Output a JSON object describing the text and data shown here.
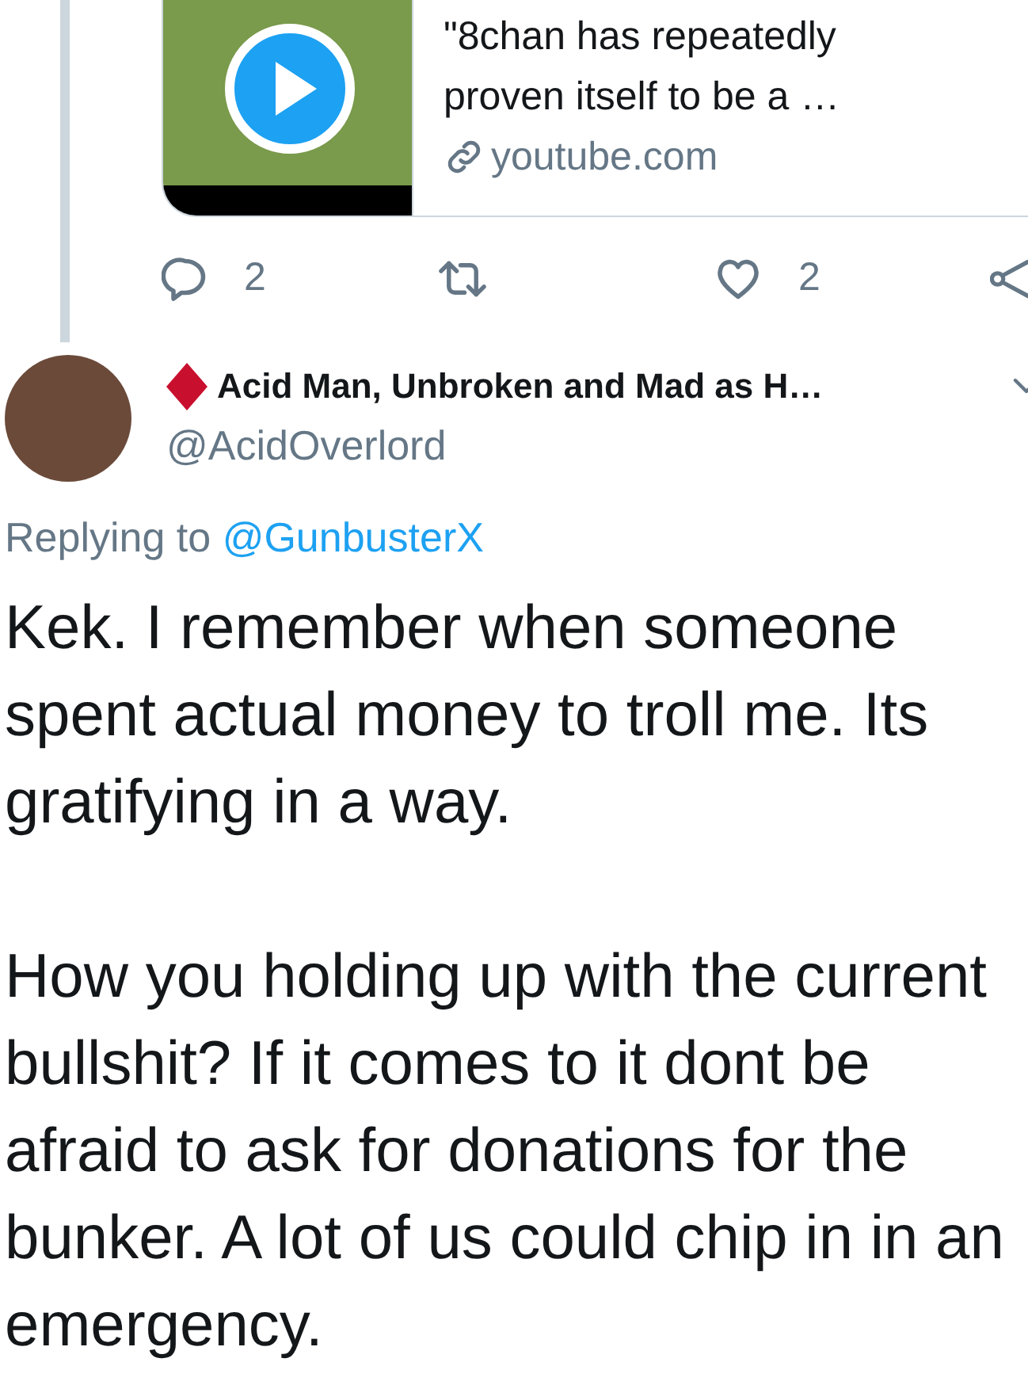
{
  "link_card": {
    "title": "\"8chan has repeatedly proven itself to be a …",
    "domain": "youtube.com"
  },
  "actions": {
    "replies": "2",
    "likes": "2"
  },
  "tweet": {
    "author": "Acid Man, Unbroken and Mad as H…",
    "handle": "@AcidOverlord",
    "replying_label": "Replying to",
    "replying_to": "@GunbusterX",
    "paragraphs": [
      "Kek. I remember when someone spent actual money to troll me. Its gratifying in a way.",
      "How you holding up with the current bullshit? If it comes to it dont be afraid to ask for donations for the bunker. A lot of us could chip in in an emergency."
    ]
  }
}
